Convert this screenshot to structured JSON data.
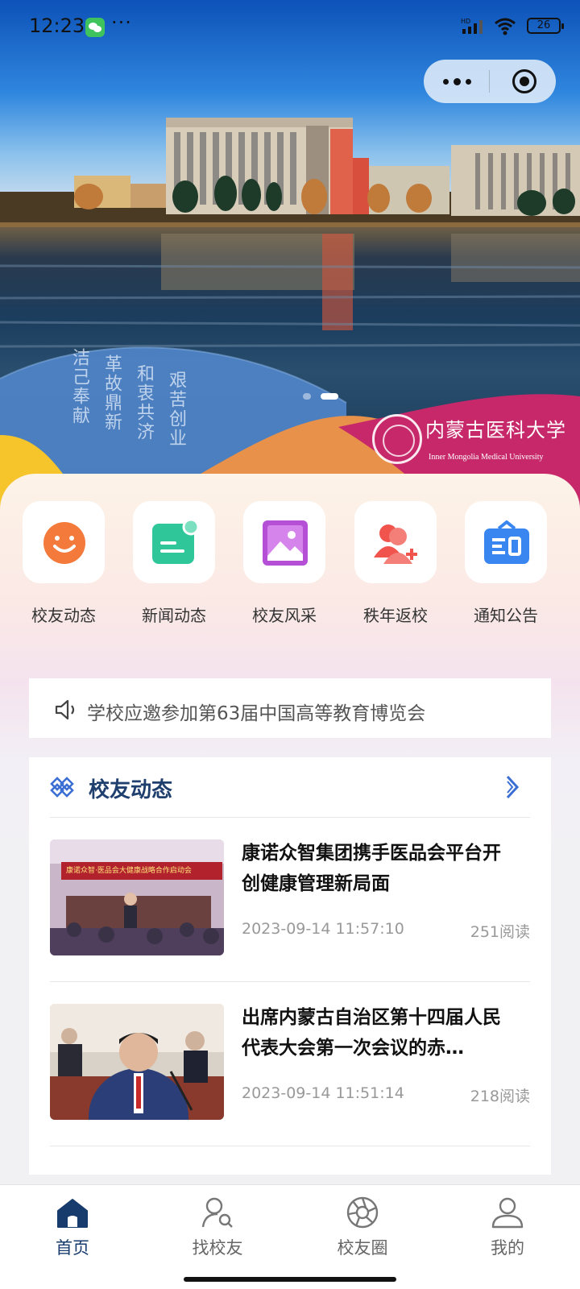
{
  "status_bar": {
    "time": "12:23",
    "dots": "···",
    "battery": "26",
    "icons": [
      "wechat-icon",
      "signal-icon",
      "wifi-icon",
      "battery-icon"
    ]
  },
  "banner": {
    "slogans": [
      "洁己奉献",
      "革故鼎新",
      "和衷共济",
      "艰苦创业"
    ],
    "logo_cn": "内蒙古医科大学",
    "logo_en": "Inner Mongolia Medical University",
    "active_dot": 1,
    "dot_count": 2
  },
  "quick_menu": [
    {
      "label": "校友动态",
      "icon": "smile-icon",
      "color": "#f47a3c"
    },
    {
      "label": "新闻动态",
      "icon": "news-icon",
      "color": "#2fc79a"
    },
    {
      "label": "校友风采",
      "icon": "picture-icon",
      "color": "#b44fd6"
    },
    {
      "label": "秩年返校",
      "icon": "add-user-icon",
      "color": "#f0544d"
    },
    {
      "label": "通知公告",
      "icon": "notice-board-icon",
      "color": "#3a86f0"
    }
  ],
  "notice": {
    "text": "学校应邀参加第63届中国高等教育博览会"
  },
  "section": {
    "title": "校友动态",
    "items": [
      {
        "title": "康诺众智集团携手医品会平台开创健康管理新局面",
        "date": "2023-09-14 11:57:10",
        "reads": "251阅读",
        "thumb_banner": "康诺众智·医品会大健康战略合作启动会"
      },
      {
        "title": "出席内蒙古自治区第十四届人民代表大会第一次会议的赤…",
        "date": "2023-09-14 11:51:14",
        "reads": "218阅读"
      }
    ]
  },
  "tab_bar": {
    "tabs": [
      {
        "label": "首页",
        "icon": "home-icon",
        "active": true
      },
      {
        "label": "找校友",
        "icon": "find-user-icon",
        "active": false
      },
      {
        "label": "校友圈",
        "icon": "aperture-icon",
        "active": false
      },
      {
        "label": "我的",
        "icon": "profile-icon",
        "active": false
      }
    ]
  },
  "colors": {
    "accent": "#173b6c",
    "section_title": "#1f3f6e",
    "muted": "#999999"
  }
}
